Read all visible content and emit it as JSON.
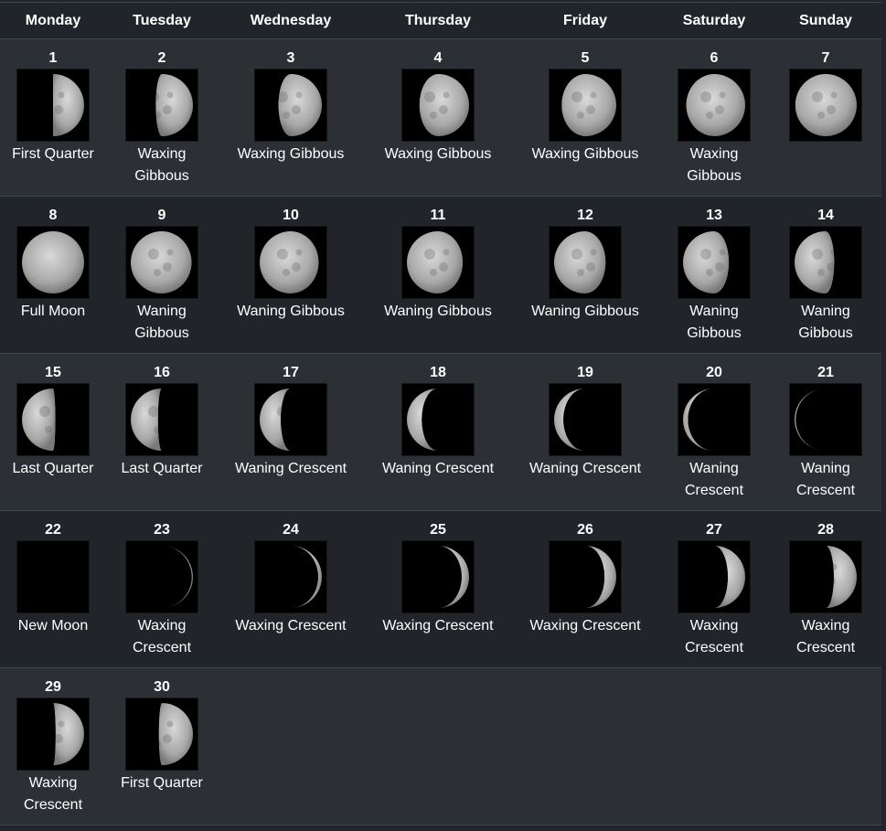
{
  "weekdays": [
    "Monday",
    "Tuesday",
    "Wednesday",
    "Thursday",
    "Friday",
    "Saturday",
    "Sunday"
  ],
  "days": [
    {
      "day": "1",
      "phase": "First Quarter",
      "illum": 0.5,
      "waxing": true
    },
    {
      "day": "2",
      "phase": "Waxing Gibbous",
      "illum": 0.6,
      "waxing": true
    },
    {
      "day": "3",
      "phase": "Waxing Gibbous",
      "illum": 0.7,
      "waxing": true
    },
    {
      "day": "4",
      "phase": "Waxing Gibbous",
      "illum": 0.8,
      "waxing": true
    },
    {
      "day": "5",
      "phase": "Waxing Gibbous",
      "illum": 0.88,
      "waxing": true
    },
    {
      "day": "6",
      "phase": "Waxing Gibbous",
      "illum": 0.95,
      "waxing": true
    },
    {
      "day": "7",
      "phase": "",
      "illum": 0.99,
      "waxing": true
    },
    {
      "day": "8",
      "phase": "Full Moon",
      "illum": 1.0,
      "waxing": false
    },
    {
      "day": "9",
      "phase": "Waning Gibbous",
      "illum": 0.98,
      "waxing": false
    },
    {
      "day": "10",
      "phase": "Waning Gibbous",
      "illum": 0.95,
      "waxing": false
    },
    {
      "day": "11",
      "phase": "Waning Gibbous",
      "illum": 0.9,
      "waxing": false
    },
    {
      "day": "12",
      "phase": "Waning Gibbous",
      "illum": 0.83,
      "waxing": false
    },
    {
      "day": "13",
      "phase": "Waning Gibbous",
      "illum": 0.74,
      "waxing": false
    },
    {
      "day": "14",
      "phase": "Waning Gibbous",
      "illum": 0.64,
      "waxing": false
    },
    {
      "day": "15",
      "phase": "Last Quarter",
      "illum": 0.54,
      "waxing": false
    },
    {
      "day": "16",
      "phase": "Last Quarter",
      "illum": 0.44,
      "waxing": false
    },
    {
      "day": "17",
      "phase": "Waning Crescent",
      "illum": 0.34,
      "waxing": false
    },
    {
      "day": "18",
      "phase": "Waning Crescent",
      "illum": 0.24,
      "waxing": false
    },
    {
      "day": "19",
      "phase": "Waning Crescent",
      "illum": 0.15,
      "waxing": false
    },
    {
      "day": "20",
      "phase": "Waning Crescent",
      "illum": 0.08,
      "waxing": false
    },
    {
      "day": "21",
      "phase": "Waning Crescent",
      "illum": 0.02,
      "waxing": false
    },
    {
      "day": "22",
      "phase": "New Moon",
      "illum": 0.0,
      "waxing": true
    },
    {
      "day": "23",
      "phase": "Waxing Crescent",
      "illum": 0.02,
      "waxing": true
    },
    {
      "day": "24",
      "phase": "Waxing Crescent",
      "illum": 0.06,
      "waxing": true
    },
    {
      "day": "25",
      "phase": "Waxing Crescent",
      "illum": 0.12,
      "waxing": true
    },
    {
      "day": "26",
      "phase": "Waxing Crescent",
      "illum": 0.19,
      "waxing": true
    },
    {
      "day": "27",
      "phase": "Waxing Crescent",
      "illum": 0.28,
      "waxing": true
    },
    {
      "day": "28",
      "phase": "Waxing Crescent",
      "illum": 0.37,
      "waxing": true
    },
    {
      "day": "29",
      "phase": "Waxing Crescent",
      "illum": 0.46,
      "waxing": true
    },
    {
      "day": "30",
      "phase": "First Quarter",
      "illum": 0.55,
      "waxing": true
    }
  ],
  "colors": {
    "background": "#212529",
    "row_alt": "#2c3035",
    "border": "#40464d",
    "text": "#ffffff"
  }
}
